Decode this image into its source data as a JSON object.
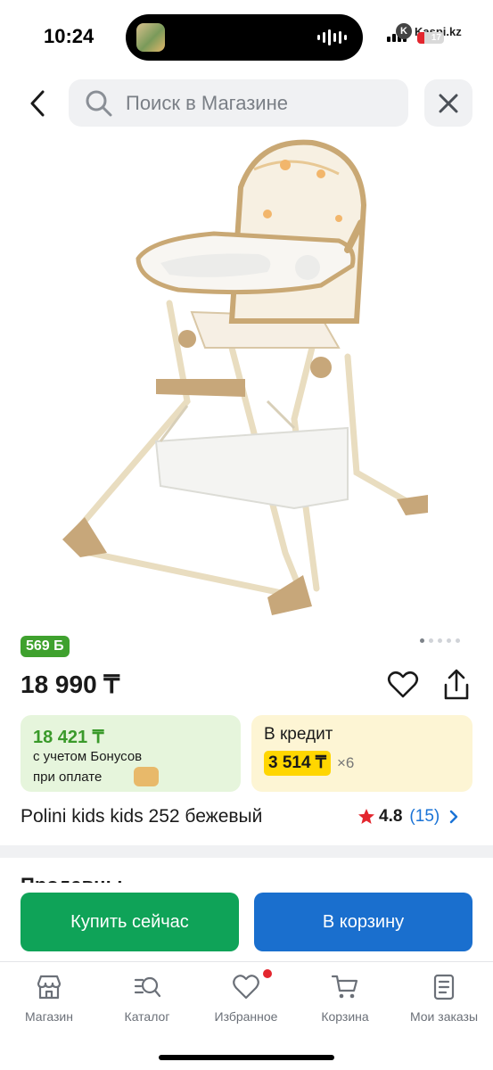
{
  "status": {
    "time": "10:24",
    "brand": "Kaspi.kz",
    "battery": "17"
  },
  "search": {
    "placeholder": "Поиск в Магазине"
  },
  "product": {
    "bonus_badge": "569 Б",
    "price": "18 990 ₸",
    "title": "Polini kids kids 252 бежевый",
    "rating": "4.8",
    "reviews": "(15)",
    "image_pages": 5,
    "current_page": 1
  },
  "bonus_card": {
    "price": "18 421 ₸",
    "line1": "с учетом Бонусов",
    "line2": "при оплате"
  },
  "credit_card": {
    "title": "В кредит",
    "amount": "3 514 ₸",
    "times": "×6"
  },
  "sellers": {
    "title": "Продавцы"
  },
  "actions": {
    "buy_now": "Купить сейчас",
    "to_cart": "В корзину"
  },
  "tabs": [
    {
      "label": "Магазин",
      "icon": "store-icon"
    },
    {
      "label": "Каталог",
      "icon": "catalog-search-icon"
    },
    {
      "label": "Избранное",
      "icon": "heart-icon"
    },
    {
      "label": "Корзина",
      "icon": "cart-icon"
    },
    {
      "label": "Мои заказы",
      "icon": "orders-icon"
    }
  ],
  "colors": {
    "green": "#0fa358",
    "blue": "#1a6fce",
    "bonus_green": "#3fa12e",
    "credit_yellow": "#ffd600",
    "accent_red": "#e3262e"
  }
}
